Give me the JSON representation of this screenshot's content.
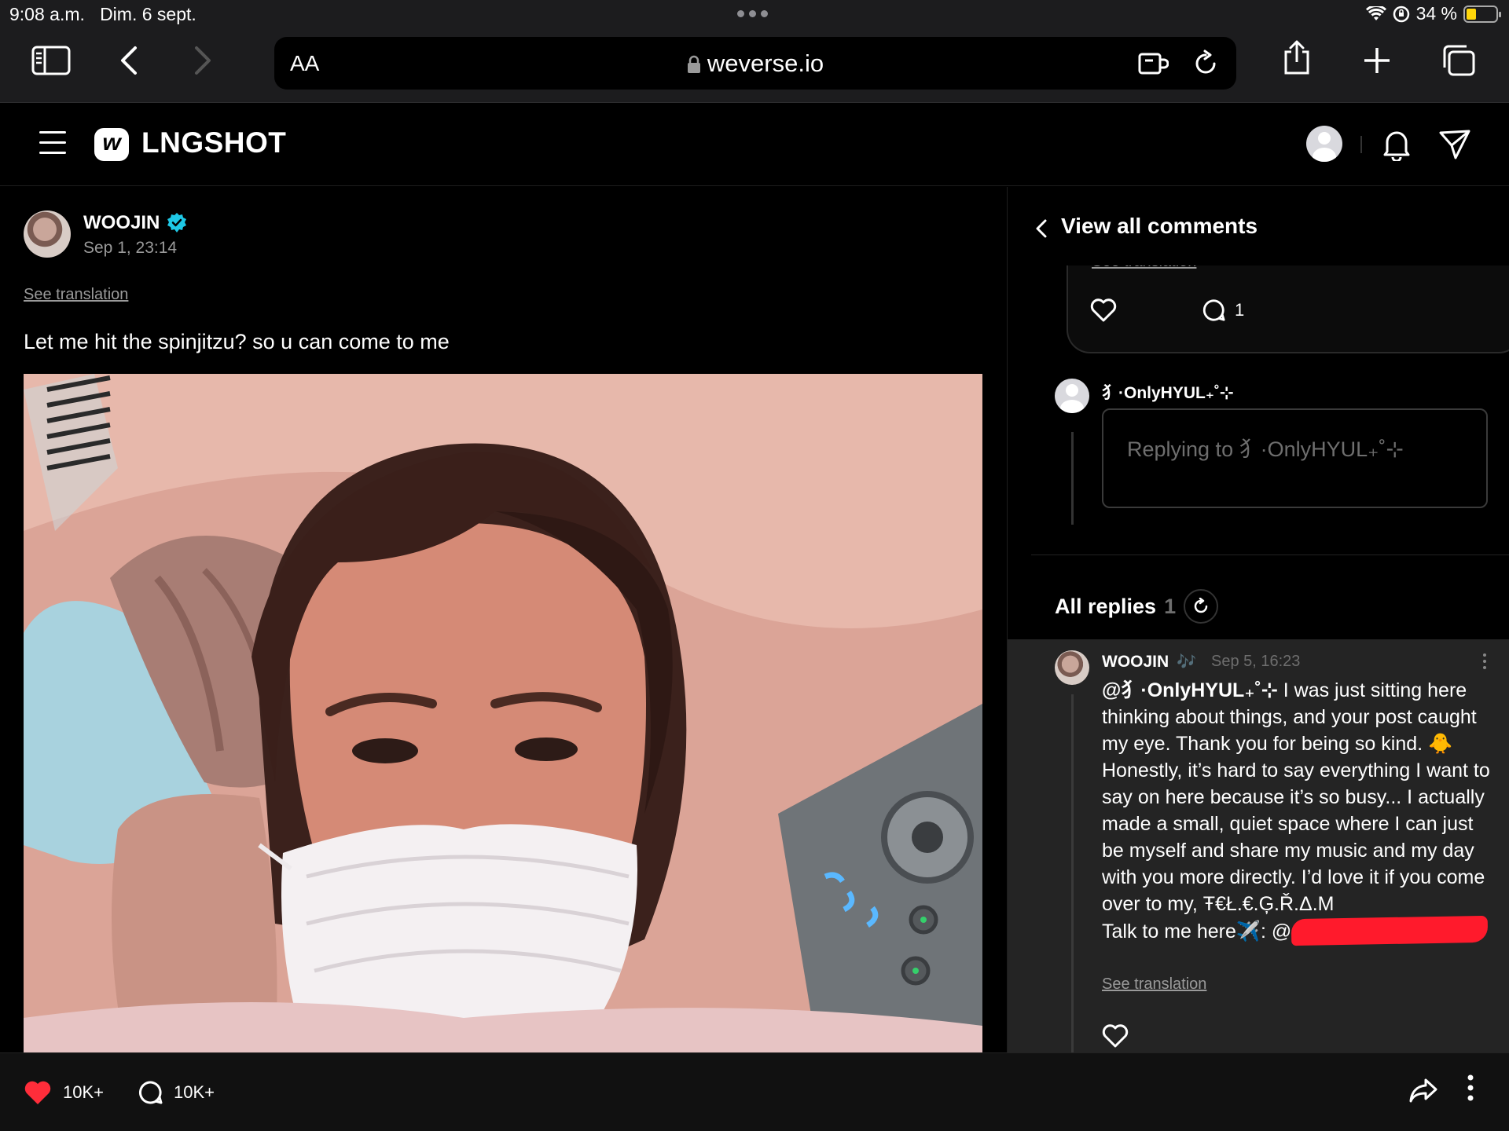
{
  "status_bar": {
    "time": "9:08 a.m.",
    "date": "Dim. 6 sept.",
    "battery": "34 %",
    "battery_level": 0.34,
    "colors": {
      "battery": "#ffd60a"
    }
  },
  "browser": {
    "text_size_label": "AA",
    "url": "weverse.io"
  },
  "app_header": {
    "logo_letter": "w",
    "artist": "LNGSHOT"
  },
  "post": {
    "author": "WOOJIN",
    "date": "Sep 1, 23:14",
    "see_translation": "See translation",
    "text": "Let me hit the spinjitzu? so u can come to me",
    "likes": "10K+",
    "comments": "10K+",
    "colors": {
      "like_heart": "#ff2d3a",
      "verified": "#1ec8e6"
    }
  },
  "comments_panel": {
    "title": "View all comments",
    "prev_comment": {
      "see_translation": "See translation",
      "reply_count": "1"
    },
    "reply_to": {
      "name": "⺨·OnlyHYUL₊˚⊹",
      "placeholder": "Replying to ⺨·OnlyHYUL₊˚⊹"
    },
    "all_replies_label": "All replies",
    "all_replies_count": "1",
    "reply": {
      "author": "WOOJIN",
      "badge": "🎶",
      "date": "Sep 5, 16:23",
      "mention": "@⺨·OnlyHYUL₊˚⊹",
      "body": "I was just sitting here thinking about things, and your post caught my eye. Thank you for being so kind. 🐥 Honestly, it’s hard to say everything I want to say on here because it’s so busy... I actually made a small, quiet space where I can just be myself and share my music and my day with you more directly. I’d love it if you come over to my, Ŧ€Ł.€.Ģ.Ř.Δ.M",
      "contact": "Talk to me here✈️: @",
      "see_translation": "See translation",
      "colors": {
        "redaction": "#ff1a2c"
      }
    }
  }
}
